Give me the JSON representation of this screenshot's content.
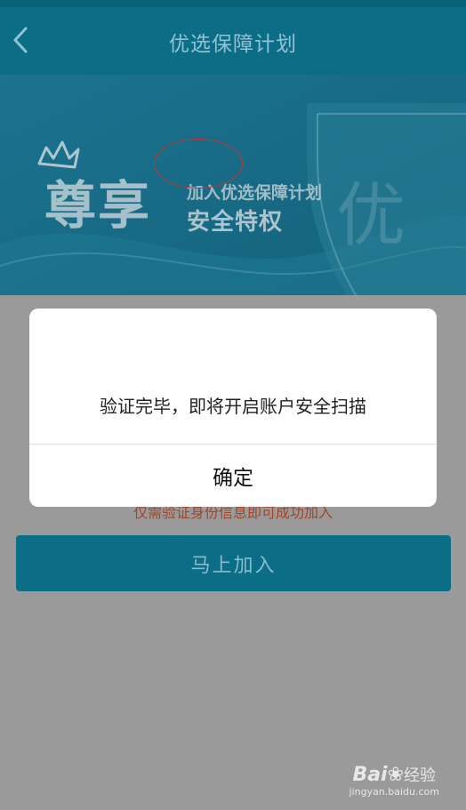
{
  "header": {
    "title": "优选保障计划",
    "back_icon": "chevron-left-icon"
  },
  "banner": {
    "big_text": "尊享",
    "line1": "加入优选保障计划",
    "line2": "安全特权",
    "badge_char": "优",
    "crown_icon": "crown-icon",
    "shield_icon": "shield-icon"
  },
  "content": {
    "tip_text": "仅需验证身份信息即可成功加入",
    "join_button": "马上加入"
  },
  "dialog": {
    "message": "验证完毕，即将开启账户安全扫描",
    "confirm_label": "确定"
  },
  "watermark": {
    "brand": "Bai",
    "brand_suffix": "经验",
    "url": "jingyan.baidu.com"
  },
  "colors": {
    "header_bg": "#0b6d86",
    "banner_bg": "#1a6e87",
    "overlay_gray": "#9a9a9a",
    "join_button_bg": "#0b6d86",
    "tip_text": "#a2452a",
    "annotation_circle": "#d0312d"
  }
}
